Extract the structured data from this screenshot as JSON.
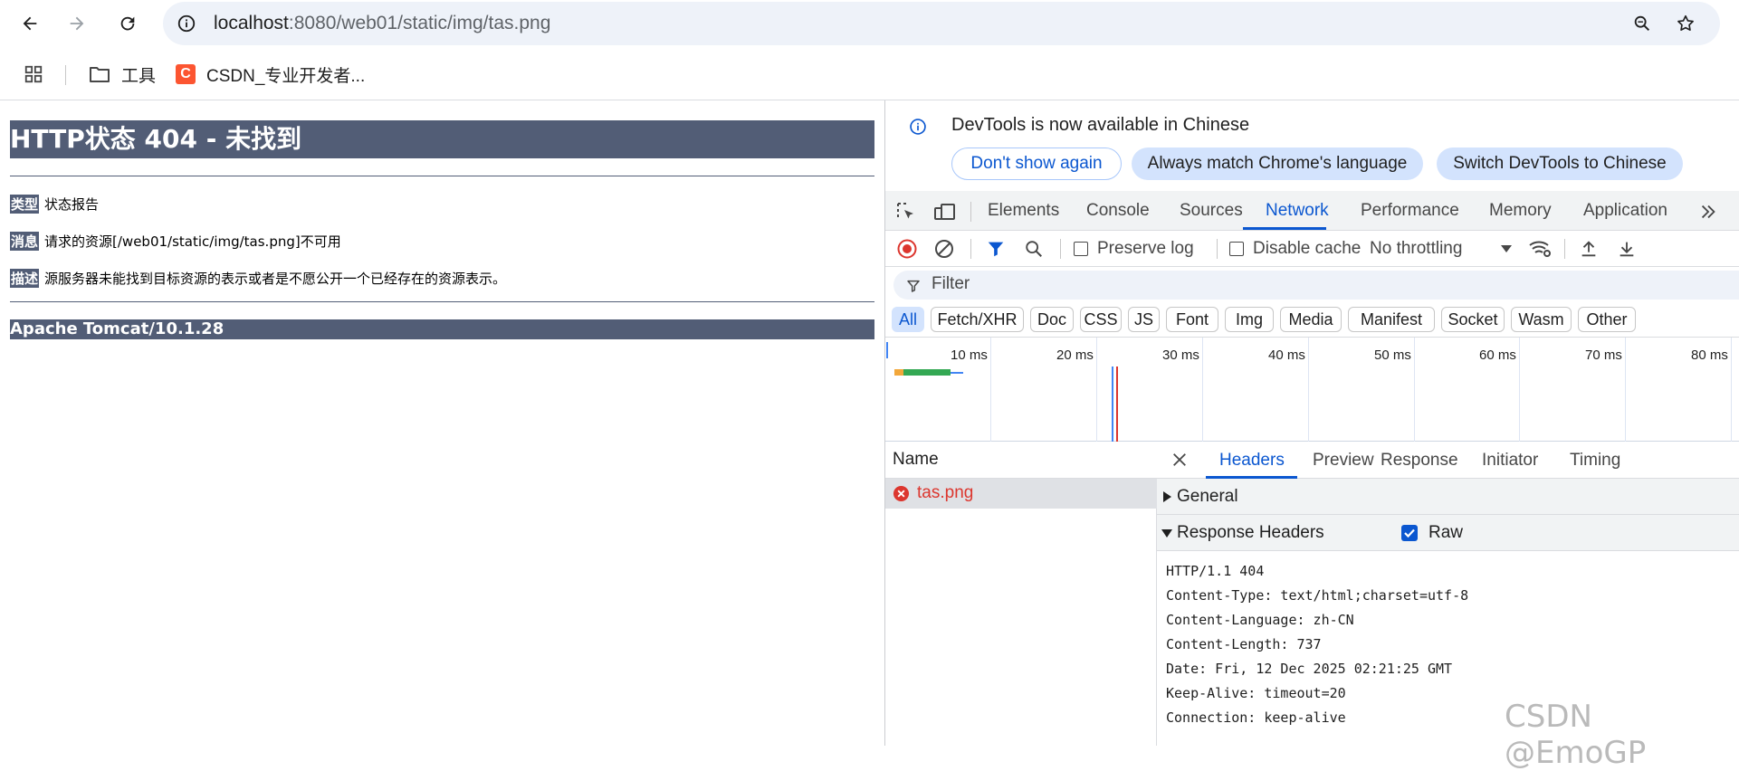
{
  "browser": {
    "url_host": "localhost",
    "url_rest": ":8080/web01/static/img/tas.png",
    "bookmarks": [
      {
        "label": "工具"
      },
      {
        "label": "CSDN_专业开发者..."
      }
    ],
    "icons": [
      "back-arrow-icon",
      "forward-arrow-icon",
      "reload-icon",
      "site-info-icon",
      "zoom-icon",
      "star-icon",
      "apps-grid-icon",
      "folder-icon",
      "csdn-logo-icon"
    ]
  },
  "page": {
    "title": "HTTP状态 404 - 未找到",
    "type_label": "类型",
    "type_value": "状态报告",
    "message_label": "消息",
    "message_value": "请求的资源[/web01/static/img/tas.png]不可用",
    "desc_label": "描述",
    "desc_value": "源服务器未能找到目标资源的表示或者是不愿公开一个已经存在的资源表示。",
    "server": "Apache Tomcat/10.1.28",
    "header_color": "#525d76"
  },
  "devtools": {
    "banner": {
      "text": "DevTools is now available in Chinese",
      "btn_dont_show": "Don't show again",
      "btn_always_match": "Always match Chrome's language",
      "btn_switch": "Switch DevTools to Chinese"
    },
    "tabs": [
      "Elements",
      "Console",
      "Sources",
      "Network",
      "Performance",
      "Memory",
      "Application"
    ],
    "active_tab": "Network",
    "toolbar": {
      "preserve_log": "Preserve log",
      "disable_cache": "Disable cache",
      "throttling": "No throttling"
    },
    "filter_placeholder": "Filter",
    "chips": [
      "All",
      "Fetch/XHR",
      "Doc",
      "CSS",
      "JS",
      "Font",
      "Img",
      "Media",
      "Manifest",
      "Socket",
      "Wasm",
      "Other"
    ],
    "active_chip": "All",
    "timeline_ticks": [
      "10 ms",
      "20 ms",
      "30 ms",
      "40 ms",
      "50 ms",
      "60 ms",
      "70 ms",
      "80 ms"
    ],
    "name_header": "Name",
    "request": {
      "name": "tas.png",
      "status": "error"
    },
    "detail_tabs": [
      "Headers",
      "Preview",
      "Response",
      "Initiator",
      "Timing"
    ],
    "active_detail_tab": "Headers",
    "section_general": "General",
    "section_response_headers": "Response Headers",
    "raw_label": "Raw",
    "raw_checked": true,
    "response_headers": [
      "HTTP/1.1 404",
      "Content-Type: text/html;charset=utf-8",
      "Content-Language: zh-CN",
      "Content-Length: 737",
      "Date: Fri, 12 Dec 2025 02:21:25 GMT",
      "Keep-Alive: timeout=20",
      "Connection: keep-alive"
    ],
    "accent": "#0b57d0",
    "error_color": "#dc362e"
  },
  "watermark": "CSDN @EmoGP"
}
